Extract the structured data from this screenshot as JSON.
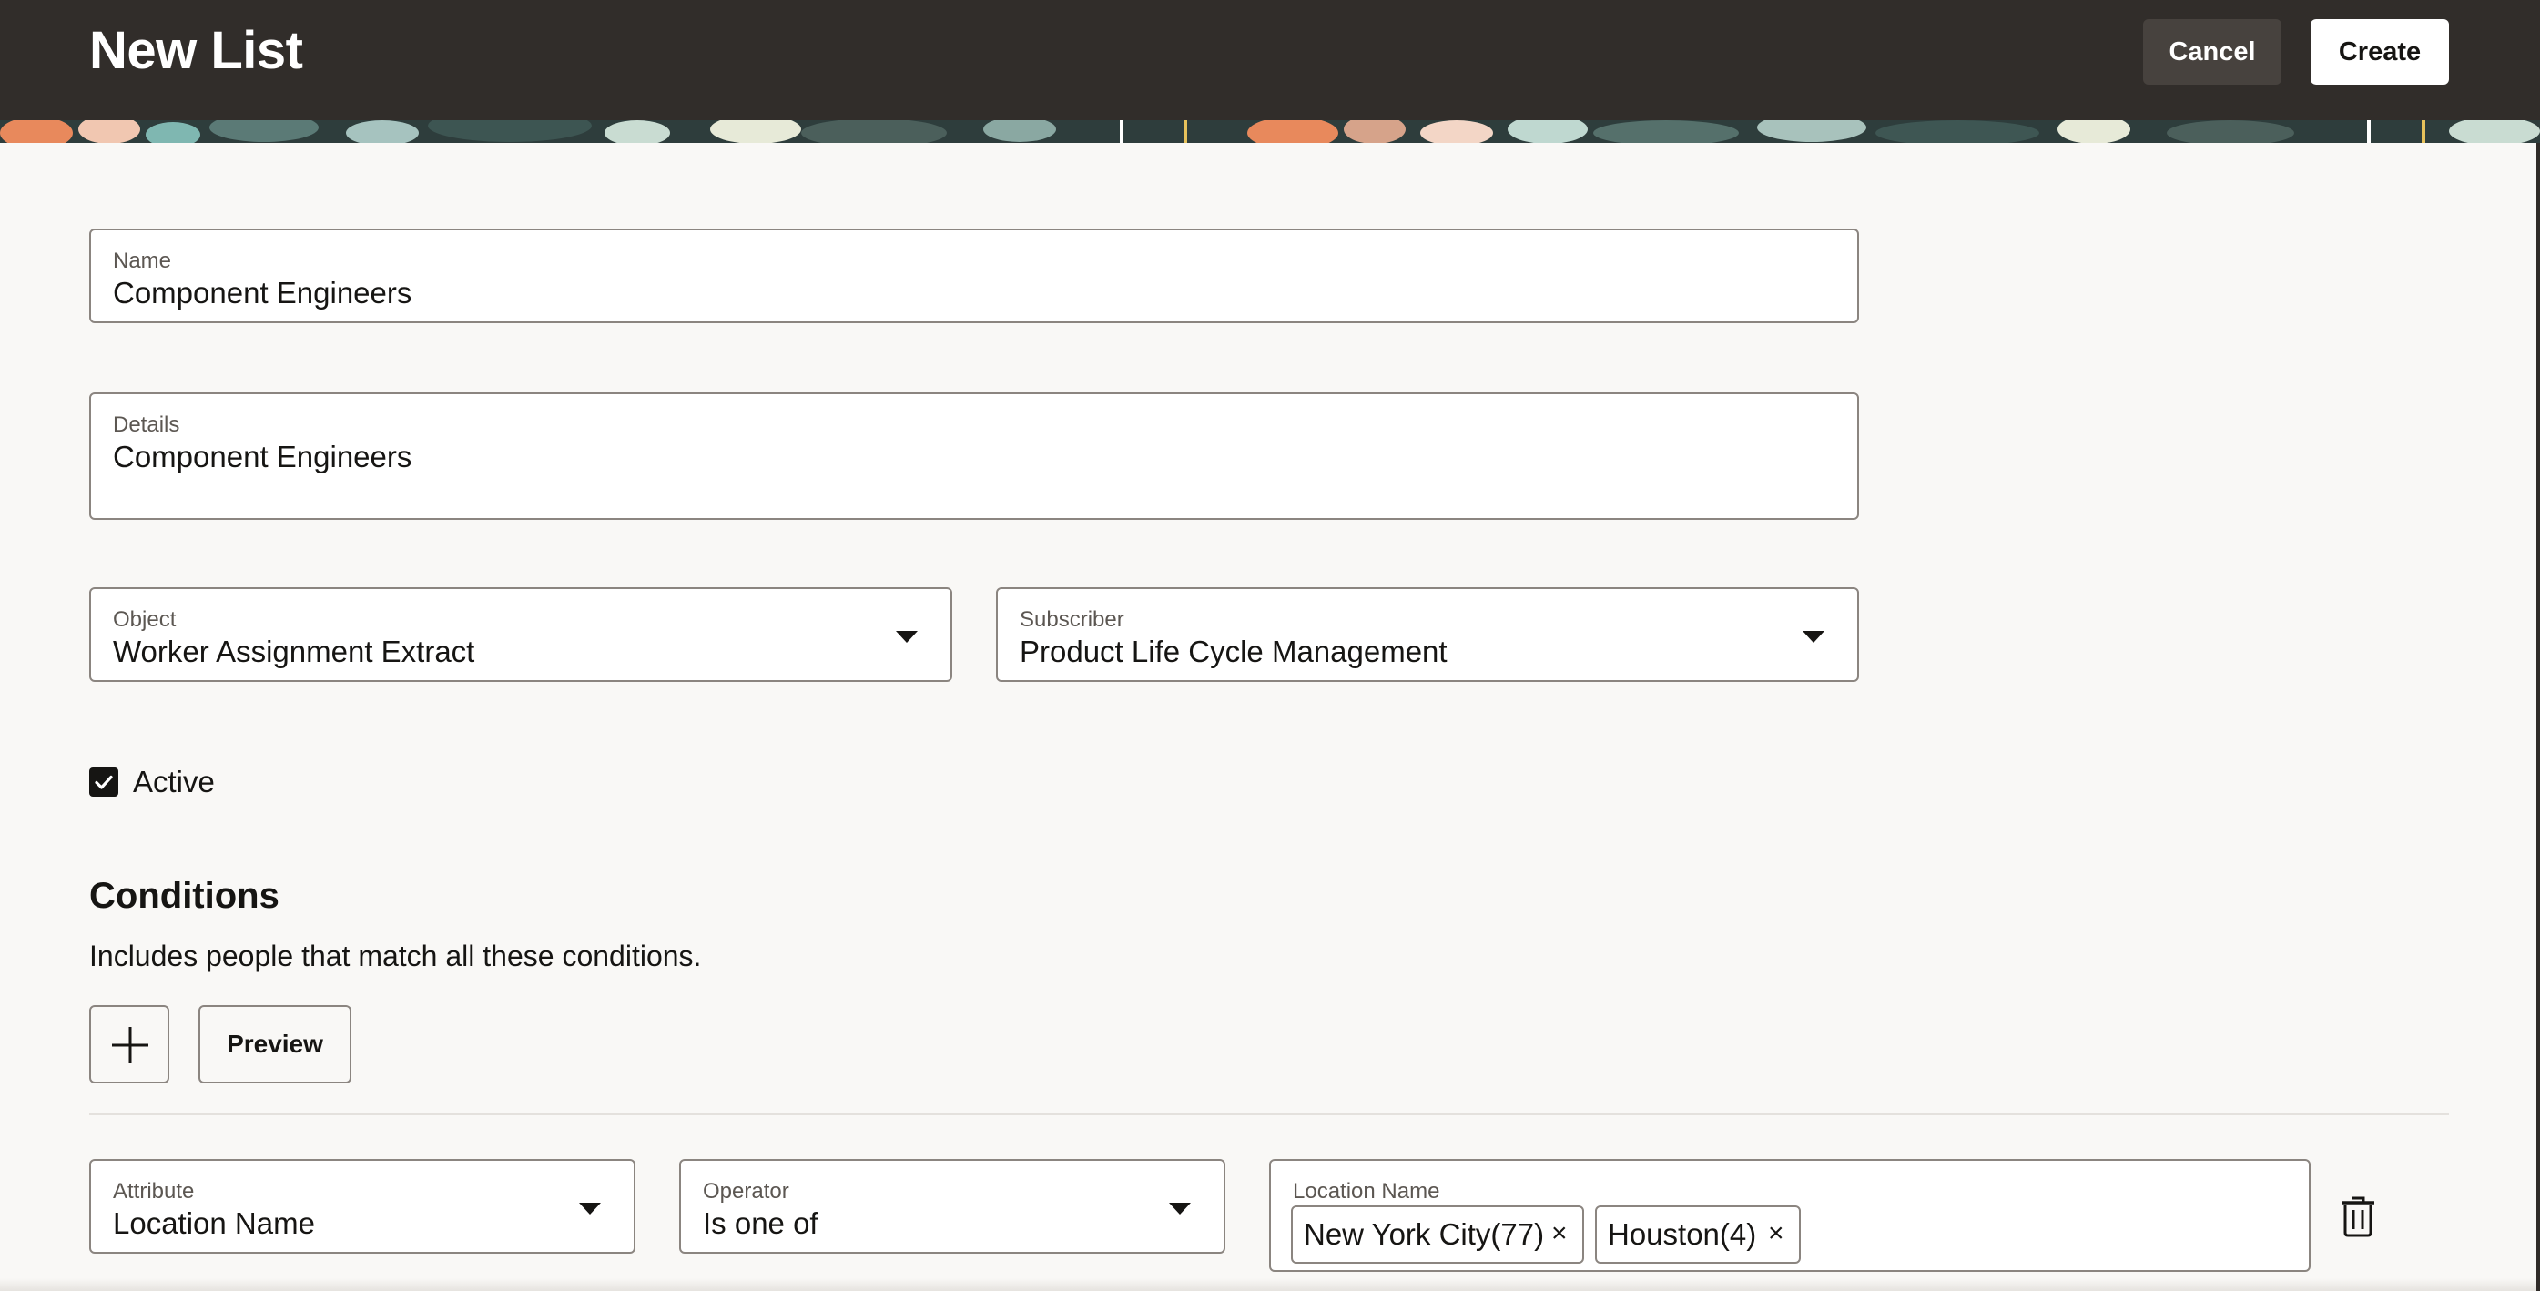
{
  "header": {
    "title": "New List",
    "cancel_label": "Cancel",
    "create_label": "Create"
  },
  "form": {
    "name": {
      "label": "Name",
      "value": "Component Engineers"
    },
    "details": {
      "label": "Details",
      "value": "Component Engineers"
    },
    "object": {
      "label": "Object",
      "value": "Worker Assignment Extract"
    },
    "subscriber": {
      "label": "Subscriber",
      "value": "Product Life Cycle Management"
    },
    "active": {
      "label": "Active",
      "checked": true
    }
  },
  "conditions": {
    "title": "Conditions",
    "description": "Includes people that match all these conditions.",
    "preview_label": "Preview",
    "row": {
      "attribute": {
        "label": "Attribute",
        "value": "Location Name"
      },
      "operator": {
        "label": "Operator",
        "value": "Is one of"
      },
      "values": {
        "label": "Location Name",
        "chips": [
          "New York City(77)",
          "Houston(4)"
        ]
      }
    }
  },
  "icons": {
    "check": "check-icon",
    "add": "plus-icon",
    "remove": "close-icon",
    "delete": "trash-icon",
    "dropdown": "caret-down-icon"
  }
}
